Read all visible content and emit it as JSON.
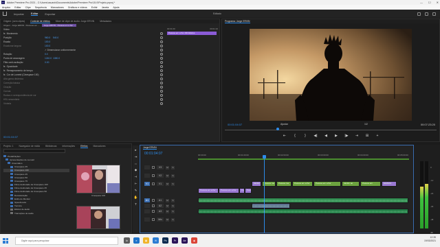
{
  "window": {
    "title": "Adobe Premiere Pro 2021 - C:\\Users\\usuario\\Documents\\Adobe\\Premiere Pro\\15.0\\Projeto.prproj *",
    "app_icon": "Pr"
  },
  "menu": [
    "Arquivo",
    "Editar",
    "Clipe",
    "Sequência",
    "Marcadores",
    "Gráficos e vídeos",
    "Exibir",
    "Janela",
    "Ajuda"
  ],
  "workspace": {
    "tabs": [
      "Importar",
      "Editar",
      "Exportar"
    ],
    "active": "Editar",
    "center": "Editado"
  },
  "effect_controls": {
    "tabs": [
      "Origem: (sem clipes)",
      "Controle de efeitos",
      "Mixer de clipe de áudio: Jorge ERVIN",
      "Metadados"
    ],
    "source": "Origem - Jorge ERVIN - Pessoas em ...",
    "sequence_chip": "Jorge ERVIN - Pessoa em a flor ...",
    "ruler": [
      "00:01:00",
      "00:01:10"
    ],
    "clip_bar": "Pessoa em a flor 200 Efeitos",
    "video_header": "Vídeo",
    "rows": [
      {
        "label": "Movimento",
        "fx": "fx"
      },
      {
        "label": "Posição",
        "v1": "960.0",
        "v2": "540.0"
      },
      {
        "label": "Escala",
        "v1": "100.0"
      },
      {
        "label": "Escalonar largura",
        "v1": "100.0",
        "dim": true
      },
      {
        "label": "",
        "v1": "✓ Dimensionar uniformemente"
      },
      {
        "label": "Rotação",
        "v1": "0.0"
      },
      {
        "label": "Ponto de ancoragem",
        "v1": "1240.0",
        "v2": "1080.0"
      },
      {
        "label": "Filtro anti-oscilação",
        "v1": "0.00"
      },
      {
        "label": "Opacidade",
        "fx": "fx"
      },
      {
        "label": "Remapeamento de tempo",
        "fx": "fx"
      },
      {
        "label": "Cor de Lumetri (Cinespace 100)",
        "fx": "fx"
      },
      {
        "label": "Alta gama dinâmica",
        "dim": true
      },
      {
        "label": "Correção básica",
        "dim": true
      },
      {
        "label": "Criação",
        "dim": true
      },
      {
        "label": "Curvas",
        "dim": true
      },
      {
        "label": "Rodas e correspondência de cor",
        "dim": true
      },
      {
        "label": "HSL secundário",
        "dim": true
      },
      {
        "label": "Vinheta",
        "dim": true
      }
    ],
    "timecode": "00:01:04:07"
  },
  "program": {
    "title": "Programa: Jorge ERVIN",
    "timecode": "00:01:04:07",
    "fit": "Ajustar",
    "resolution": "1/2",
    "duration": "00:07:23:20",
    "controls": [
      "⇤",
      "{",
      "}",
      "◀|",
      "◀",
      "▶",
      "|▶",
      "⇥",
      "⊞",
      "+"
    ]
  },
  "project": {
    "tabs": [
      "Projeto: 1",
      "Navegador de mídia",
      "Bibliotecas",
      "Informações",
      "Efeitos",
      "Marcadores"
    ],
    "tree": [
      {
        "label": "Predefinições",
        "fx": true
      },
      {
        "label": "Apresentações de Lumetri",
        "fx": true
      },
      {
        "label": "Cinemático",
        "fx": true
      },
      {
        "label": "Cinespace 25",
        "fx": true
      },
      {
        "label": "Cinespace 100",
        "fx": true,
        "sel": true
      },
      {
        "label": "Cinespace 25",
        "fx": true
      },
      {
        "label": "Cinespace 50",
        "fx": true
      },
      {
        "label": "Cinespace 75",
        "fx": true
      },
      {
        "label": "Filme desbotado de Cinespace 100",
        "fx": true
      },
      {
        "label": "Filme desbotado de Cinespace 25",
        "fx": true
      },
      {
        "label": "Filme desbotado de Cinespace 50",
        "fx": true
      },
      {
        "label": "Dessaturação",
        "fx": true
      },
      {
        "label": "Estilo do Monitor",
        "fx": true
      },
      {
        "label": "SpeedLooks",
        "fx": true
      },
      {
        "label": "Técnico",
        "fx": true
      },
      {
        "label": "Efeitos de áudio",
        "fx": false
      },
      {
        "label": "Transições de áudio",
        "fx": false
      }
    ],
    "thumb_label": "Cinespace 100"
  },
  "tools": [
    "▸",
    "⇥",
    "⇔",
    "◆",
    "⊣",
    "⊢",
    "✎",
    "✋",
    "T"
  ],
  "timeline": {
    "tab": "Jorge ERVIN",
    "timecode": "00:01:04:07",
    "ruler": [
      "00:00:00",
      "00:01:00:00",
      "00:02:00:00",
      "00:03:00:00",
      "00:04:00:00",
      "00:05:00:00"
    ],
    "tracks": [
      {
        "name": "V3",
        "src": ""
      },
      {
        "name": "V2",
        "src": ""
      },
      {
        "name": "V1",
        "src": "V1"
      },
      {
        "name": "A1",
        "src": "A1"
      },
      {
        "name": "A2",
        "src": ""
      },
      {
        "name": "A3",
        "src": ""
      },
      {
        "name": "Mix",
        "src": ""
      }
    ],
    "clips_v1": [
      "Pessoa em a flor",
      "Pessoa em a flor",
      "Pessoa",
      "Pess"
    ],
    "clips_v2": [
      "Jardim g",
      "Pessoa ma",
      "Pessoa ma",
      "Pessoa em a flor",
      "Pessoa em a flor",
      "Jardim ao",
      "Pessoa em",
      "GRAFIA"
    ]
  },
  "meters": {
    "labels": [
      "0",
      "-12",
      "-24",
      "-36",
      "-48",
      "dB"
    ],
    "levels": [
      0.62,
      0.66
    ]
  },
  "taskbar": {
    "search": "Digite aqui para pesquisar",
    "apps": [
      {
        "label": "⧉",
        "color": "#5c5c5c"
      },
      {
        "label": "e",
        "color": "#1f73c9"
      },
      {
        "label": "▣",
        "color": "#f0b429"
      },
      {
        "label": "✉",
        "color": "#2b7cd3"
      },
      {
        "label": "Ps",
        "color": "#0b2a4f"
      },
      {
        "label": "Pr",
        "color": "#2a1358"
      },
      {
        "label": "Ae",
        "color": "#2a1358"
      },
      {
        "label": "◉",
        "color": "#db4437"
      }
    ],
    "time": "12:35",
    "date": "19/03/2021"
  }
}
